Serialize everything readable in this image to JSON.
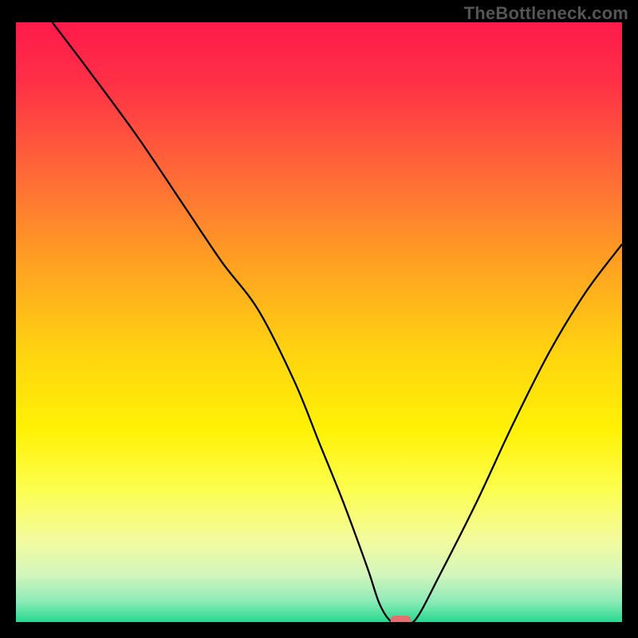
{
  "watermark": "TheBottleneck.com",
  "chart_data": {
    "type": "line",
    "title": "",
    "xlabel": "",
    "ylabel": "",
    "xlim": [
      0,
      100
    ],
    "ylim": [
      0,
      100
    ],
    "grid": false,
    "background": "vertical-gradient red→yellow→green over black frame",
    "series": [
      {
        "name": "curve",
        "x": [
          6,
          12,
          20,
          28,
          34,
          40,
          46,
          50,
          54,
          58,
          60,
          62,
          64,
          66,
          70,
          76,
          82,
          88,
          94,
          100
        ],
        "y": [
          100,
          92,
          81,
          69,
          60,
          52,
          40,
          30,
          20,
          9,
          3,
          0,
          0,
          0.5,
          8,
          20,
          33,
          45,
          55,
          63
        ]
      }
    ],
    "annotations": [
      {
        "name": "min-marker",
        "shape": "rounded-rect",
        "x": 63.5,
        "y": 0,
        "color": "#e46f6e"
      }
    ],
    "gradient_stops": [
      {
        "offset": 0.0,
        "color": "#ff1a4b"
      },
      {
        "offset": 0.1,
        "color": "#ff3046"
      },
      {
        "offset": 0.25,
        "color": "#ff6838"
      },
      {
        "offset": 0.4,
        "color": "#ffa022"
      },
      {
        "offset": 0.55,
        "color": "#ffd310"
      },
      {
        "offset": 0.68,
        "color": "#fff205"
      },
      {
        "offset": 0.78,
        "color": "#fcfe50"
      },
      {
        "offset": 0.86,
        "color": "#f4fb9a"
      },
      {
        "offset": 0.92,
        "color": "#d4f6bc"
      },
      {
        "offset": 0.965,
        "color": "#8eebb8"
      },
      {
        "offset": 1.0,
        "color": "#25d98f"
      }
    ]
  }
}
